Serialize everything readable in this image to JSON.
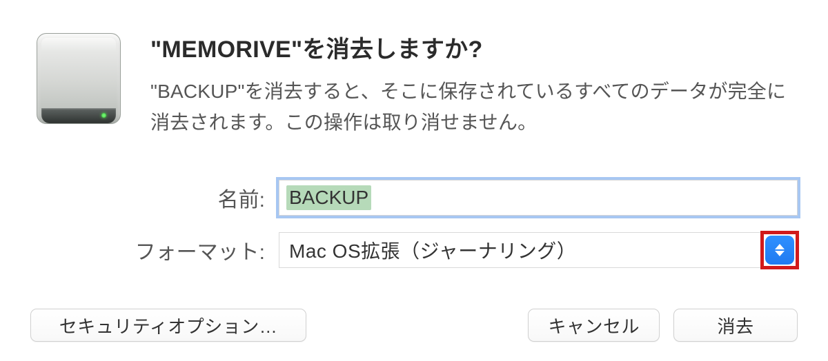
{
  "dialog": {
    "title": "\"MEMORIVE\"を消去しますか?",
    "description": "\"BACKUP\"を消去すると、そこに保存されているすべてのデータが完全に消去されます。この操作は取り消せません。"
  },
  "form": {
    "name_label": "名前:",
    "name_value": "BACKUP",
    "format_label": "フォーマット:",
    "format_value": "Mac OS拡張（ジャーナリング）"
  },
  "buttons": {
    "security": "セキュリティオプション…",
    "cancel": "キャンセル",
    "erase": "消去"
  },
  "icons": {
    "drive": "external-drive-icon",
    "stepper": "select-stepper-icon"
  }
}
